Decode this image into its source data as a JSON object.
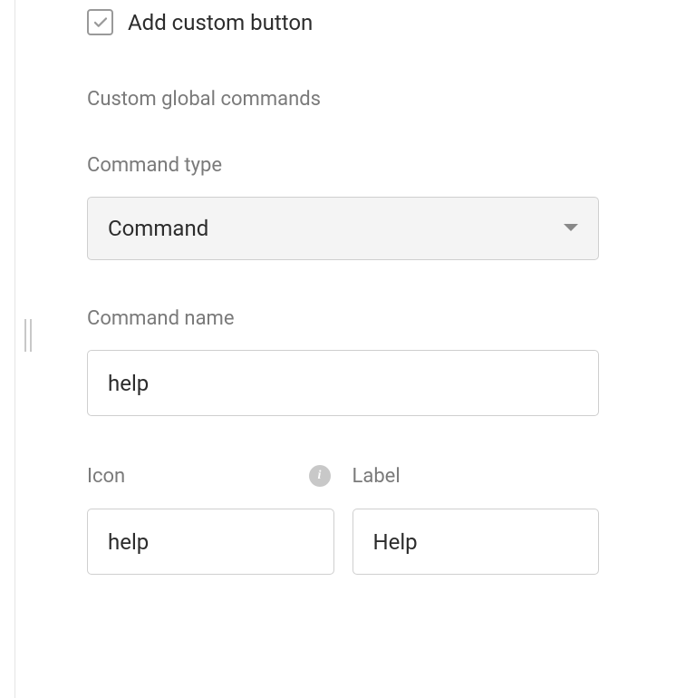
{
  "checkbox": {
    "label": "Add custom button",
    "checked": true
  },
  "section_title": "Custom global commands",
  "command_type": {
    "label": "Command type",
    "value": "Command"
  },
  "command_name": {
    "label": "Command name",
    "value": "help"
  },
  "icon": {
    "label": "Icon",
    "value": "help"
  },
  "label_field": {
    "label": "Label",
    "value": "Help"
  }
}
